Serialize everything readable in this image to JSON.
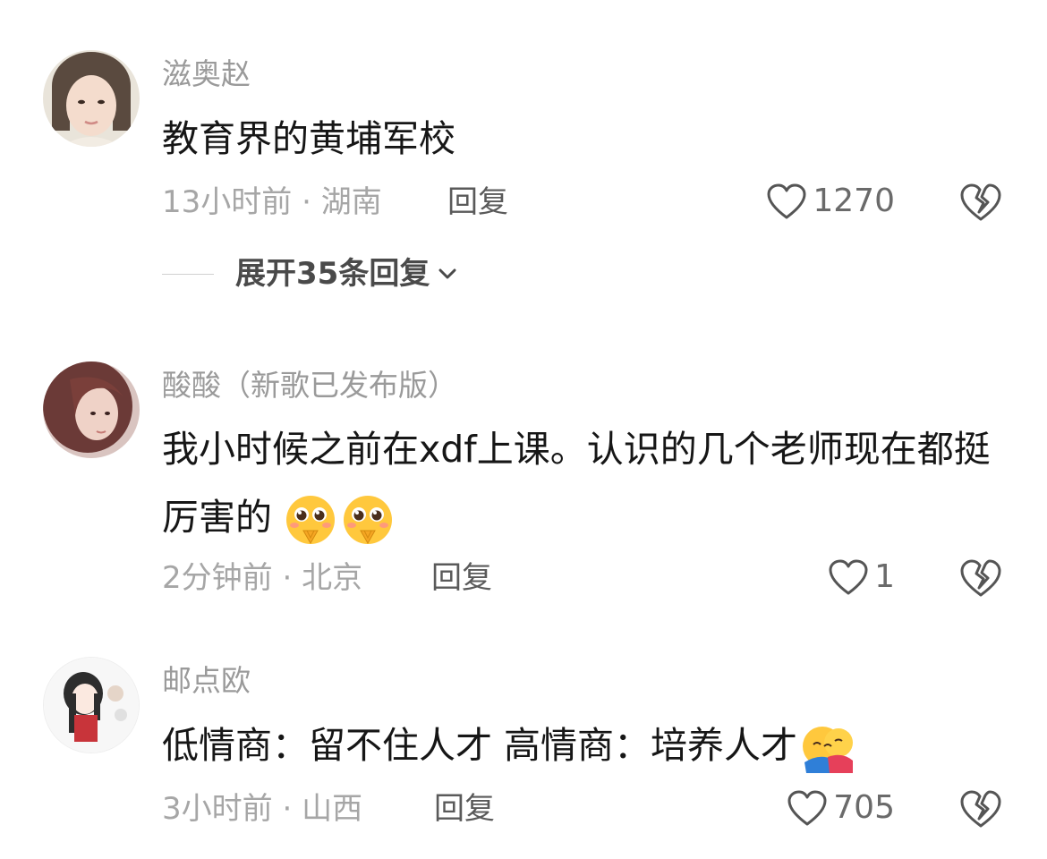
{
  "comments": [
    {
      "username": "滋奥赵",
      "text": "教育界的黄埔军校",
      "emoji": "",
      "time": "13小时前",
      "location": "湖南",
      "reply": "回复",
      "likes": "1270",
      "expand": "展开35条回复"
    },
    {
      "username": "酸酸（新歌已发布版）",
      "text": "我小时候之前在xdf上课。认识的几个老师现在都挺厉害的",
      "emoji": "pleading-face-emoji x2",
      "time": "2分钟前",
      "location": "北京",
      "reply": "回复",
      "likes": "1"
    },
    {
      "username": "邮点欧",
      "text": "低情商：留不住人才 高情商：培养人才",
      "emoji": "hug-emoji",
      "time": "3小时前",
      "location": "山西",
      "reply": "回复",
      "likes": "705"
    }
  ],
  "meta_separator": "·",
  "colors": {
    "username": "#9a9a9a",
    "body_text": "#161616",
    "meta": "#a6a6a6"
  },
  "icons": [
    "heart-outline-icon",
    "broken-heart-icon",
    "chevron-down-icon"
  ]
}
